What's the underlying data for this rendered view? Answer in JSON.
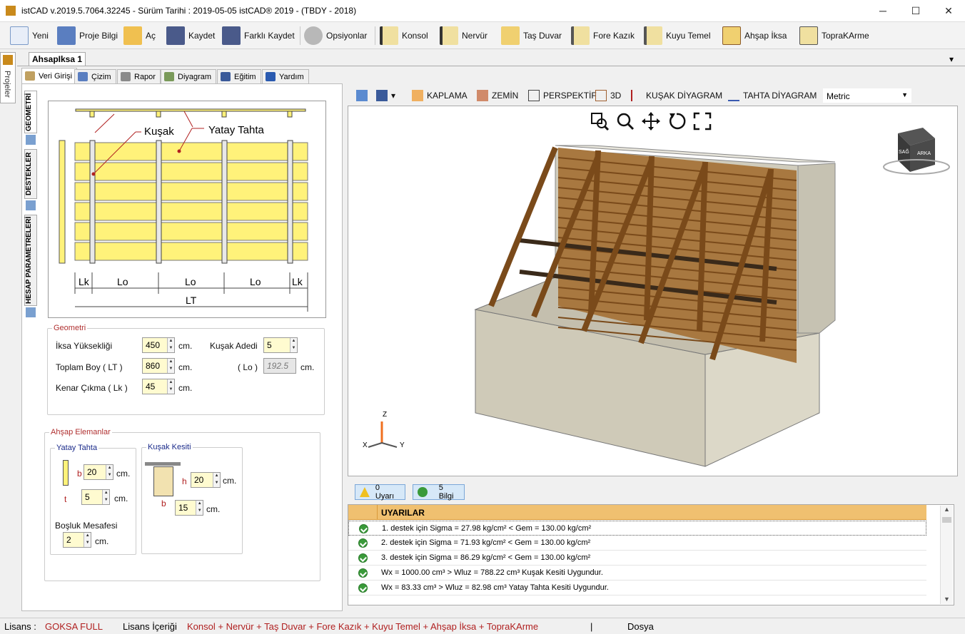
{
  "window": {
    "title": "istCAD v.2019.5.7064.32245 -  Sürüm Tarihi : 2019-05-05        istCAD® 2019 - (TBDY - 2018)",
    "minimize": "─",
    "maximize": "☐",
    "close": "✕"
  },
  "toolbar": {
    "yeni": "Yeni",
    "proje_bilgi": "Proje Bilgi",
    "ac": "Aç",
    "kaydet": "Kaydet",
    "farkli_kaydet": "Farklı Kaydet",
    "opsiyonlar": "Opsiyonlar",
    "konsol": "Konsol",
    "nervur": "Nervür",
    "tas_duvar": "Taş Duvar",
    "fore_kazik": "Fore Kazık",
    "kuyu_temel": "Kuyu Temel",
    "ahsap_iksa": "Ahşap İksa",
    "toprakarme": "TopraKArme"
  },
  "side_tab": "Projeler",
  "doc_tab": "AhsapIksa 1",
  "doc_dropdown": "▾",
  "subtabs": {
    "veri_girisi": "Veri Girişi",
    "cizim": "Çizim",
    "rapor": "Rapor",
    "diyagram": "Diyagram",
    "egitim": "Eğitim",
    "yardim": "Yardım"
  },
  "vtabs": {
    "geometri": "GEOMETRİ",
    "destekler": "DESTEKLER",
    "hesap": "HESAP PARAMETRELERİ"
  },
  "diagram": {
    "kusak": "Kuşak",
    "yatay_tahta": "Yatay Tahta",
    "lk": "Lk",
    "lo": "Lo",
    "lt": "LT"
  },
  "geometri": {
    "legend": "Geometri",
    "iksa_yuksekligi_label": "İksa Yüksekliği",
    "iksa_yuksekligi": "450",
    "toplam_boy_label": "Toplam Boy    ( LT )",
    "toplam_boy": "860",
    "kenar_cikma_label": "Kenar Çıkma   ( Lk )",
    "kenar_cikma": "45",
    "kusak_adedi_label": "Kuşak Adedi",
    "kusak_adedi": "5",
    "lo_label": "( Lo )",
    "lo": "192.5",
    "unit": "cm."
  },
  "ahsap": {
    "legend": "Ahşap Elemanlar",
    "yatay_tahta_legend": "Yatay Tahta",
    "b_label": "b",
    "t_label": "t",
    "yatay_b": "20",
    "yatay_t": "5",
    "bosluk_label": "Boşluk Mesafesi",
    "bosluk": "2",
    "kusak_legend": "Kuşak Kesiti",
    "h_label": "h",
    "kusak_h": "20",
    "kusak_b": "15",
    "unit": "cm."
  },
  "view_toolbar": {
    "kaplama": "KAPLAMA",
    "zemin": "ZEMİN",
    "perspektif": "PERSPEKTİF",
    "threed": "3D",
    "kusak_diyagram": "KUŞAK DİYAGRAM",
    "tahta_diyagram": "TAHTA DİYAGRAM",
    "units": "Metric"
  },
  "viewcube": {
    "sag": "SAĞ",
    "arka": "ARKA"
  },
  "axes": {
    "z": "Z",
    "x": "X",
    "y": "Y"
  },
  "status_buttons": {
    "uyari": "0 Uyarı",
    "bilgi": "5 Bilgi"
  },
  "messages": {
    "header": "UYARILAR",
    "rows": [
      "1. destek için Sigma = 27.98 kg/cm² < Gem = 130.00 kg/cm²",
      "2. destek için Sigma = 71.93 kg/cm² < Gem = 130.00 kg/cm²",
      "3. destek için Sigma = 86.29 kg/cm² < Gem = 130.00 kg/cm²",
      "Wx = 1000.00 cm³ > Wluz = 788.22 cm³ Kuşak Kesiti Uygundur.",
      "Wx = 83.33 cm³ > Wluz = 82.98 cm³ Yatay Tahta Kesiti Uygundur."
    ]
  },
  "statusbar": {
    "lisans_label": "Lisans :",
    "lisans": "GOKSA FULL",
    "icerigi_label": "Lisans İçeriği",
    "icerigi": "Konsol + Nervür + Taş Duvar + Fore Kazık + Kuyu Temel + Ahşap İksa + TopraKArme",
    "divider": "|",
    "dosya": "Dosya"
  },
  "colors": {
    "plank_yellow": "#fff27a",
    "wood": "#8a5a2a",
    "accent_red": "#b02020",
    "header_orange": "#f0c070"
  }
}
